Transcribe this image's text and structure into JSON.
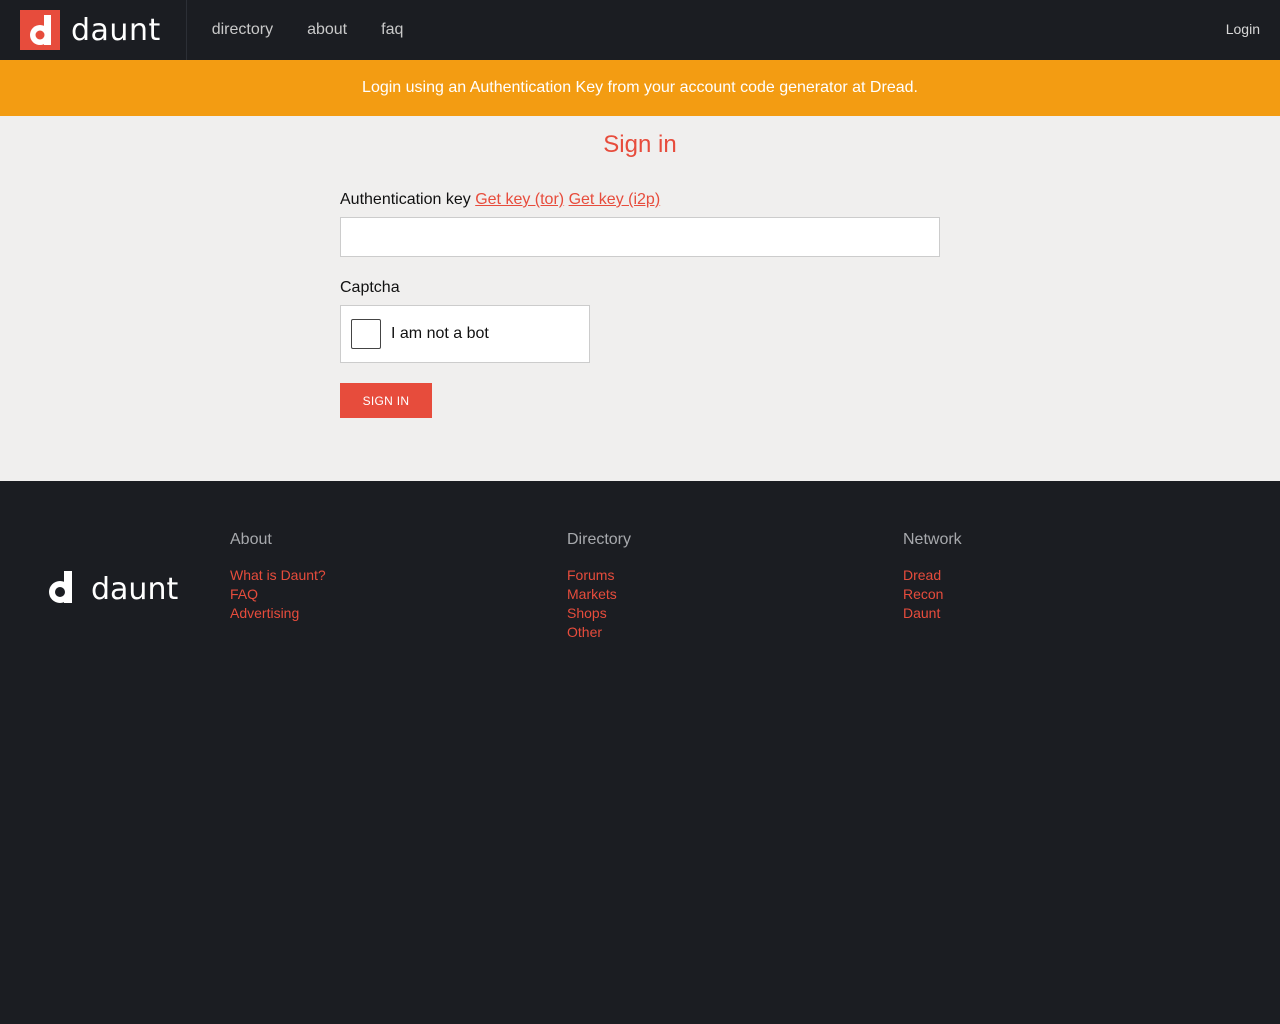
{
  "header": {
    "brand": "daunt",
    "nav": [
      "directory",
      "about",
      "faq"
    ],
    "login": "Login"
  },
  "banner": {
    "text": "Login using an Authentication Key from your account code generator at Dread."
  },
  "form": {
    "title": "Sign in",
    "auth_label": "Authentication key",
    "get_key_tor": "Get key (tor)",
    "get_key_i2p": "Get key (i2p)",
    "auth_value": "",
    "captcha_label": "Captcha",
    "captcha_text": "I am not a bot",
    "captcha_checked": false,
    "submit": "SIGN IN"
  },
  "footer": {
    "brand": "daunt",
    "columns": [
      {
        "title": "About",
        "links": [
          "What is Daunt?",
          "FAQ",
          "Advertising"
        ]
      },
      {
        "title": "Directory",
        "links": [
          "Forums",
          "Markets",
          "Shops",
          "Other"
        ]
      },
      {
        "title": "Network",
        "links": [
          "Dread",
          "Recon",
          "Daunt"
        ]
      }
    ]
  },
  "colors": {
    "accent": "#e74c3c",
    "banner": "#f39c12",
    "dark": "#1b1d22",
    "page_bg": "#f0efee"
  }
}
